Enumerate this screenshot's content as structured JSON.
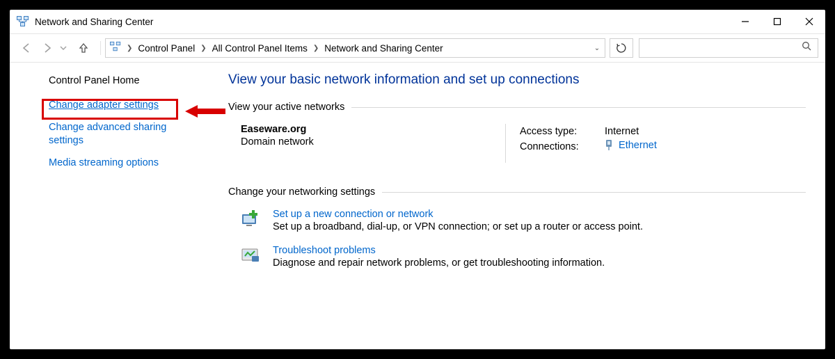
{
  "title": "Network and Sharing Center",
  "breadcrumb": [
    "Control Panel",
    "All Control Panel Items",
    "Network and Sharing Center"
  ],
  "sidebar": {
    "home": "Control Panel Home",
    "items": [
      "Change adapter settings",
      "Change advanced sharing settings",
      "Media streaming options"
    ]
  },
  "main": {
    "heading": "View your basic network information and set up connections",
    "section1": "View your active networks",
    "network": {
      "name": "Easeware.org",
      "type": "Domain network",
      "access_label": "Access type:",
      "access_value": "Internet",
      "conn_label": "Connections:",
      "conn_value": "Ethernet"
    },
    "section2": "Change your networking settings",
    "setup": {
      "title": "Set up a new connection or network",
      "desc": "Set up a broadband, dial-up, or VPN connection; or set up a router or access point."
    },
    "trouble": {
      "title": "Troubleshoot problems",
      "desc": "Diagnose and repair network problems, or get troubleshooting information."
    }
  }
}
